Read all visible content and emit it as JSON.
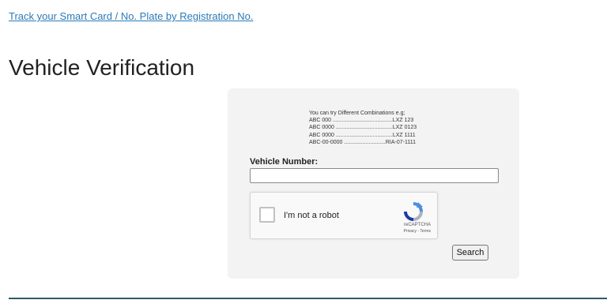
{
  "header": {
    "track_link": "Track your Smart Card / No. Plate by Registration No."
  },
  "page": {
    "title": "Vehicle Verification"
  },
  "form": {
    "hint_title": "You can try Different Combinations e.g;",
    "hints": [
      "ABC 000 .......................................LXZ 123",
      "ABC 0000 .....................................LXZ 0123",
      "ABC 0000 .....................................LXZ 1111",
      "ABC-00-0000 ...........................RIA-07-1111"
    ],
    "field_label": "Vehicle Number:",
    "field_value": "",
    "captcha": {
      "label": "I'm not a robot",
      "brand": "reCAPTCHA",
      "links": "Privacy - Terms",
      "checked": false
    },
    "search_label": "Search"
  },
  "colors": {
    "link": "#2a7ab8",
    "panel_bg": "#f3f3f3",
    "bottom_rule": "#2d5a66"
  }
}
